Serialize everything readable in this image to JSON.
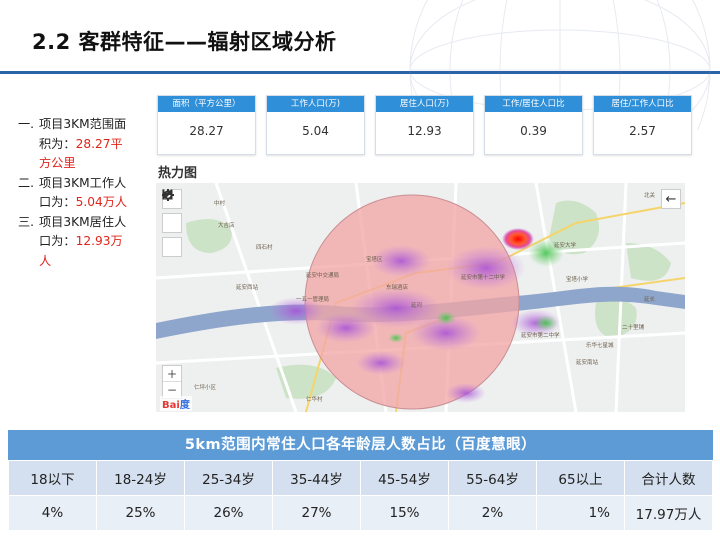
{
  "page_title": "2.2 客群特征——辐射区域分析",
  "bullets": [
    {
      "num": "一.",
      "text": "项目3KM范围面积为：",
      "highlight": "28.27平方公里"
    },
    {
      "num": "二.",
      "text": "项目3KM工作人口为：",
      "highlight": "5.04万人"
    },
    {
      "num": "三.",
      "text": "项目3KM居住人口为：",
      "highlight": "12.93万人"
    }
  ],
  "stats": [
    {
      "label": "面积（平方公里）",
      "value": "28.27"
    },
    {
      "label": "工作人口(万)",
      "value": "5.04"
    },
    {
      "label": "居住人口(万)",
      "value": "12.93"
    },
    {
      "label": "工作/居住人口比",
      "value": "0.39"
    },
    {
      "label": "居住/工作人口比",
      "value": "2.57"
    }
  ],
  "heatmap_label": "热力图",
  "map": {
    "logo_red": "Bai",
    "logo_blue": "度",
    "zoom_in": "+",
    "zoom_out": "−",
    "back_icon": "←",
    "places": [
      "中村",
      "大吉店",
      "四石村",
      "延安中交通局",
      "延安西站",
      "一五一管理局",
      "延河",
      "宝塔区",
      "延安市第十二中学",
      "延安市第二中学",
      "延安大学",
      "东瑞酒店",
      "仁坪小区",
      "乐华七星城",
      "延安南站",
      "仁华村",
      "北关",
      "二十里铺",
      "宝塔小学",
      "延长"
    ],
    "colors": {
      "river": "#8fa6cc",
      "circle_fill": "#f2a6a6",
      "circle_stroke": "#c98e93",
      "hot": "#e8212b"
    }
  },
  "table": {
    "title": "5km范围内常住人口各年龄层人数占比（百度慧眼）",
    "headers": [
      "18以下",
      "18-24岁",
      "25-34岁",
      "35-44岁",
      "45-54岁",
      "55-64岁",
      "65以上",
      "合计人数"
    ],
    "values": [
      "4%",
      "25%",
      "26%",
      "27%",
      "15%",
      "2%",
      "1%",
      "17.97万人"
    ]
  }
}
